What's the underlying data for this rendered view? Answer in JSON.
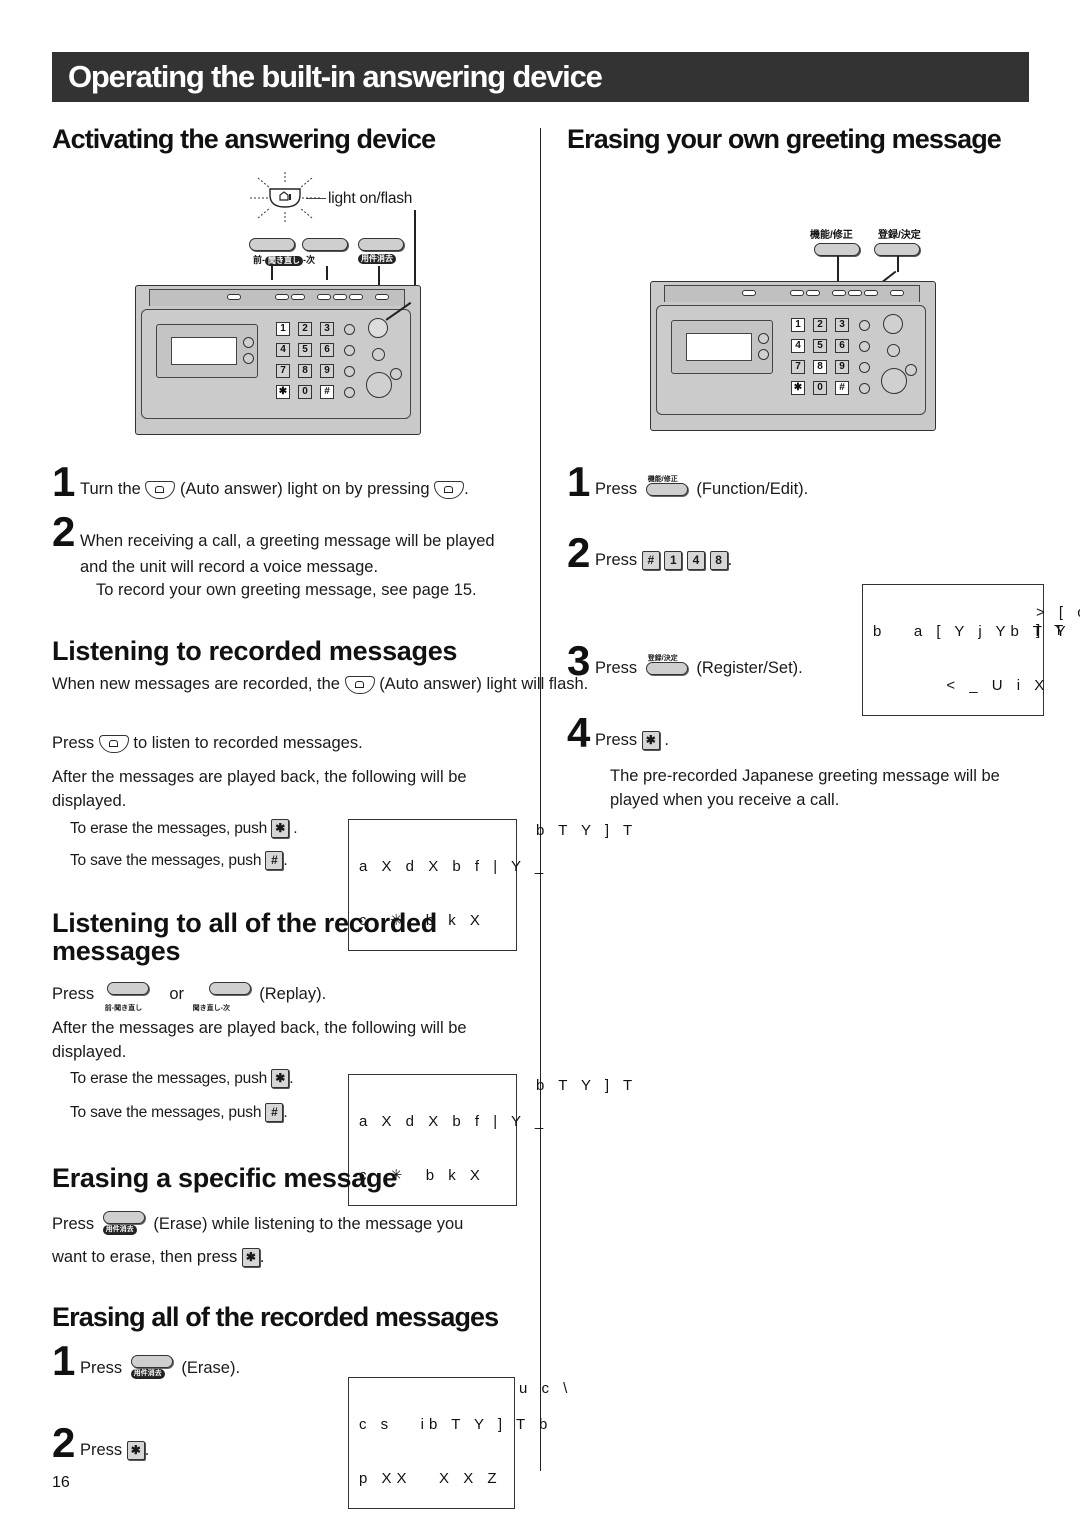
{
  "page": {
    "title": "Operating the built-in answering device",
    "page_number": "16"
  },
  "left": {
    "activating": {
      "heading": "Activating the answering device",
      "diagram": {
        "light_label": "light on/flash",
        "button_labels": [
          "前-",
          "聞き直し",
          "-次",
          "用件消去"
        ],
        "keypad": [
          "1",
          "2",
          "3",
          "4",
          "5",
          "6",
          "7",
          "8",
          "9",
          "*",
          "0",
          "#"
        ]
      },
      "steps": [
        {
          "num": "1",
          "text_before": "Turn the",
          "text_middle": "(Auto answer) light on by pressing",
          "text_after": "."
        },
        {
          "num": "2",
          "text": "When receiving a call, a greeting message will be played and the unit will record a voice message.",
          "note": "To record your own greeting message, see page 15."
        }
      ]
    },
    "listening": {
      "heading": "Listening to recorded messages",
      "p1_before": "When new messages are recorded, the",
      "p1_after": "(Auto answer) light will flash.",
      "p2_before": "Press",
      "p2_after": "to listen to recorded messages.",
      "p3": "After the messages are played back, the following will be displayed.",
      "erase_text": "To erase the messages, push",
      "save_text": "To save the messages, push",
      "lcd_line1": "a X d X b f | Y _",
      "lcd_line2": "c  ✳  b k X",
      "lcd_overflow": "b T Y ] T"
    },
    "listening_all": {
      "heading": "Listening to all of the recorded messages",
      "p1_before": "Press",
      "p1_or": "or",
      "p1_after": "(Replay).",
      "btn_label_prev": "前-聞き直し",
      "btn_label_next": "聞き直し-次",
      "p2": "After the messages are played back, the following will be displayed.",
      "erase_text": "To erase the messages, push",
      "save_text": "To save the messages, push",
      "lcd_line1": "a X d X b f | Y _",
      "lcd_line2": "c  ✳  b k X",
      "lcd_overflow": "b T Y ] T"
    },
    "erase_specific": {
      "heading": "Erasing a specific message",
      "p1_before": "Press",
      "p1_after": "(Erase) while listening to the message you",
      "p2_before": "want to erase, then press",
      "p2_after": ".",
      "btn_label": "用件消去"
    },
    "erase_all": {
      "heading": "Erasing all of the recorded messages",
      "step1_num": "1",
      "step1_before": "Press",
      "step1_after": "(Erase).",
      "btn_label": "用件消去",
      "lcd_line1": "c s   ib T Y ] T b",
      "lcd_line2": "p XX   X X Z",
      "lcd_overflow": "u c \\",
      "step2_num": "2",
      "step2_before": "Press",
      "step2_after": "."
    }
  },
  "right": {
    "heading": "Erasing your own greeting message",
    "diagram": {
      "button_labels": [
        "機能/修正",
        "登録/決定"
      ],
      "keypad": [
        "1",
        "2",
        "3",
        "4",
        "5",
        "6",
        "7",
        "8",
        "9",
        "*",
        "0",
        "#"
      ]
    },
    "steps": [
      {
        "num": "1",
        "before": "Press",
        "btn_label": "機能/修正",
        "after": "(Function/Edit)."
      },
      {
        "num": "2",
        "before": "Press",
        "keys": [
          "#",
          "1",
          "4",
          "8"
        ],
        "after": "."
      },
      {
        "num": "3",
        "before": "Press",
        "btn_label": "登録/決定",
        "after": "(Register/Set)."
      },
      {
        "num": "4",
        "before": "Press",
        "key": "*",
        "after": ".",
        "note": "The pre-recorded Japanese greeting message will be played when you receive a call."
      }
    ],
    "lcd_line1": "b   a [ Y j Yb T Y",
    "lcd_line2": "        < _ U i X",
    "lcd_overflow1": "] T",
    "lcd_overflow2": "> [ c"
  }
}
